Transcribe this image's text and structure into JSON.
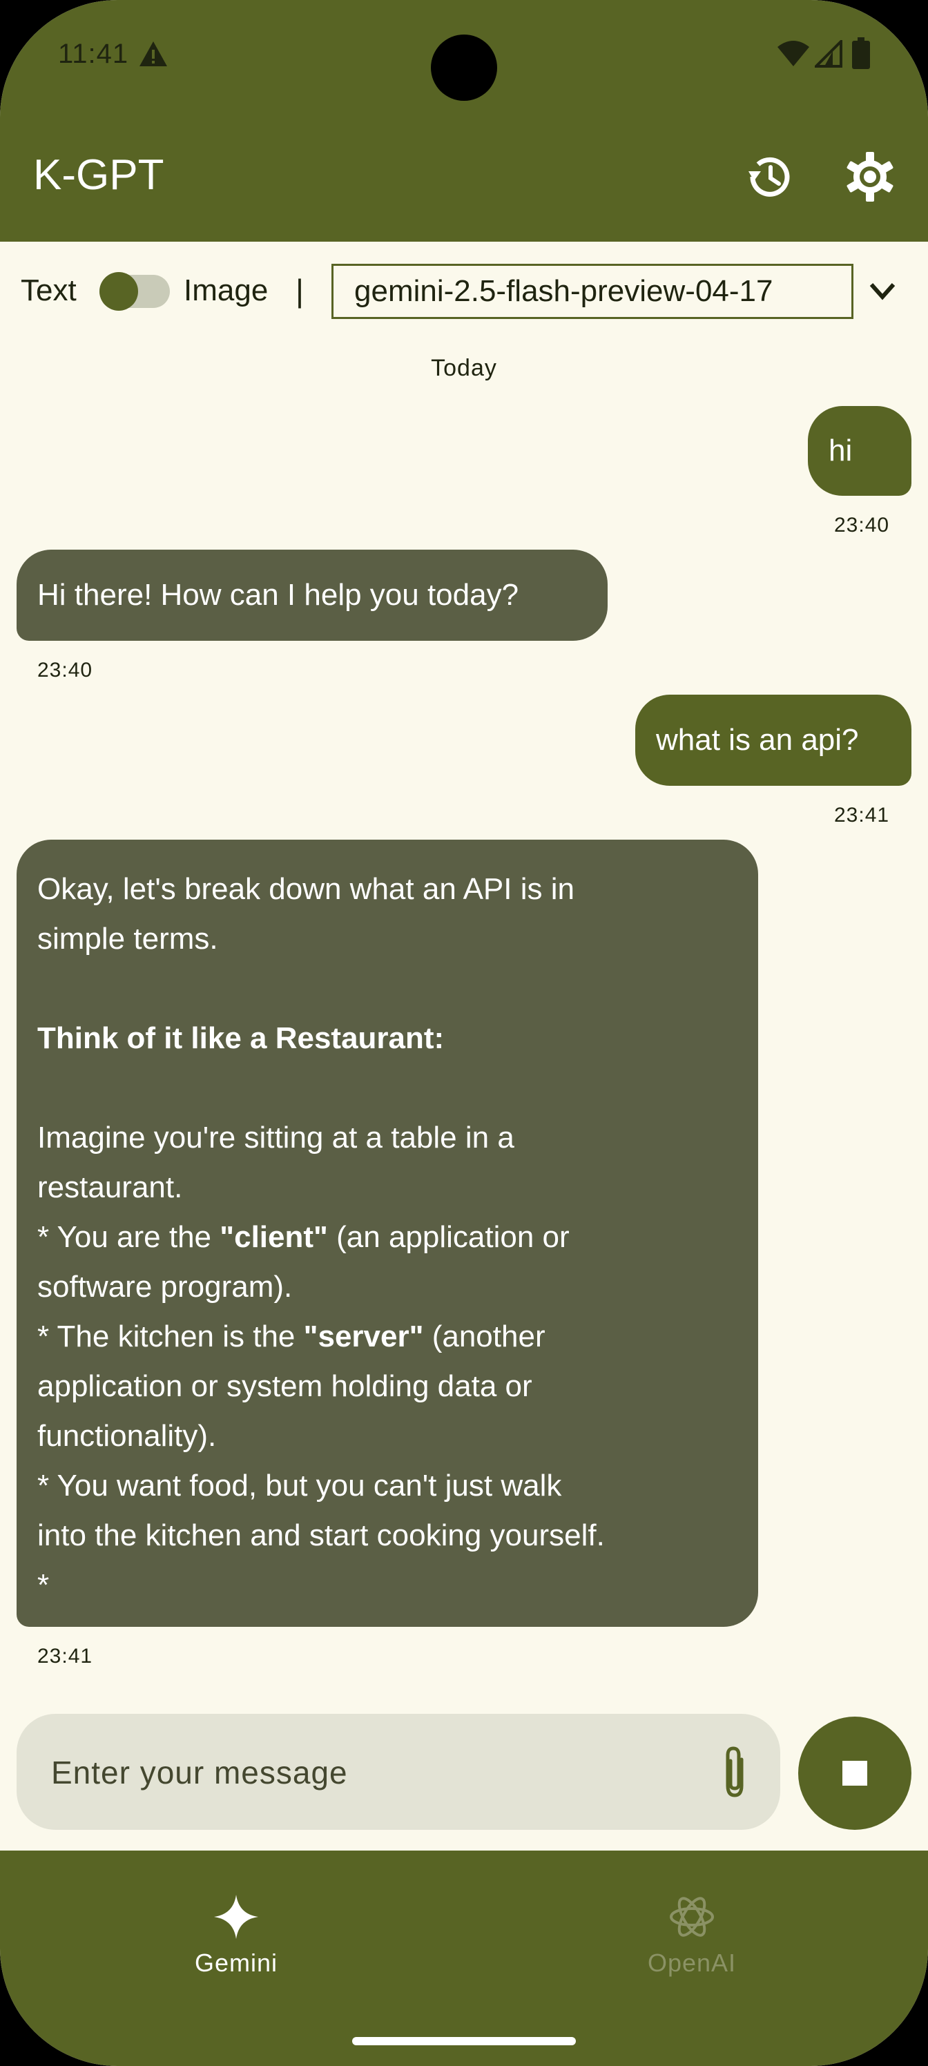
{
  "status_bar": {
    "time": "11:41"
  },
  "app_bar": {
    "title": "K-GPT"
  },
  "mode_bar": {
    "text_label": "Text",
    "image_label": "Image",
    "separator": "|",
    "model": "gemini-2.5-flash-preview-04-17"
  },
  "chat": {
    "date_divider": "Today",
    "messages": [
      {
        "role": "user",
        "text": "hi",
        "time": "23:40"
      },
      {
        "role": "assistant",
        "text": "Hi there! How can I help you today?",
        "time": "23:40"
      },
      {
        "role": "user",
        "text": "what is an api?",
        "time": "23:41"
      },
      {
        "role": "assistant",
        "time": "23:41",
        "lines": [
          "Okay, let's break down what an API is in",
          "simple terms.",
          "",
          "Think of it like a Restaurant:",
          "",
          "Imagine you're sitting at a table in a",
          "restaurant.",
          "*   You are the ",
          "\"client\"",
          " (an application or",
          "software program).",
          "*   The kitchen is the ",
          "\"server\"",
          " (another",
          "application or system holding data or",
          "functionality).",
          "*   You want food, but you can't just walk",
          "into the kitchen and start cooking yourself.",
          "*"
        ]
      }
    ]
  },
  "composer": {
    "placeholder": "Enter your message"
  },
  "bottom_nav": {
    "items": [
      {
        "label": "Gemini",
        "active": true
      },
      {
        "label": "OpenAI",
        "active": false
      }
    ]
  },
  "colors": {
    "primary": "#586424",
    "background": "#FBF9EC",
    "assistant_bubble": "#5B5F45",
    "composer": "#E3E3D5"
  }
}
